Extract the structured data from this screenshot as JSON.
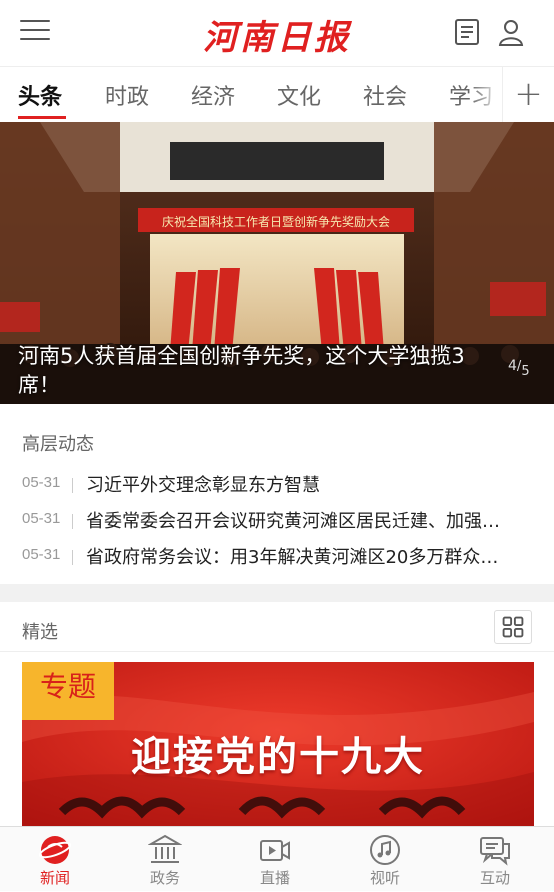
{
  "header": {
    "logo_text": "河南日报",
    "menu_icon": "hamburger-menu-icon",
    "news_icon": "newspaper-icon",
    "user_icon": "user-profile-icon",
    "accent_color": "#e02020"
  },
  "tabs": {
    "items": [
      {
        "label": "头条",
        "active": true
      },
      {
        "label": "时政",
        "active": false
      },
      {
        "label": "经济",
        "active": false
      },
      {
        "label": "文化",
        "active": false
      },
      {
        "label": "社会",
        "active": false
      },
      {
        "label": "学习",
        "active": false
      }
    ],
    "add_label": "+"
  },
  "hero": {
    "banner_text": "庆祝全国科技工作者日暨创新争先奖励大会",
    "caption": "河南5人获首届全国创新争先奖，这个大学独揽3席！",
    "pager_current": "4",
    "pager_total": "5"
  },
  "leadership": {
    "title": "高层动态",
    "items": [
      {
        "date": "05-31",
        "title": "习近平外交理念彰显东方智慧"
      },
      {
        "date": "05-31",
        "title": "省委常委会召开会议研究黄河滩区居民迁建、加强…"
      },
      {
        "date": "05-31",
        "title": "省政府常务会议：用3年解决黄河滩区20多万群众…"
      }
    ]
  },
  "featured": {
    "title": "精选",
    "grid_icon": "grid-view-icon",
    "banner_badge": "专题",
    "banner_title": "迎接党的十九大"
  },
  "bottom_nav": {
    "items": [
      {
        "label": "新闻",
        "icon": "news-globe-icon",
        "active": true
      },
      {
        "label": "政务",
        "icon": "government-building-icon",
        "active": false
      },
      {
        "label": "直播",
        "icon": "live-video-icon",
        "active": false
      },
      {
        "label": "视听",
        "icon": "music-note-icon",
        "active": false
      },
      {
        "label": "互动",
        "icon": "chat-bubble-icon",
        "active": false
      }
    ]
  }
}
